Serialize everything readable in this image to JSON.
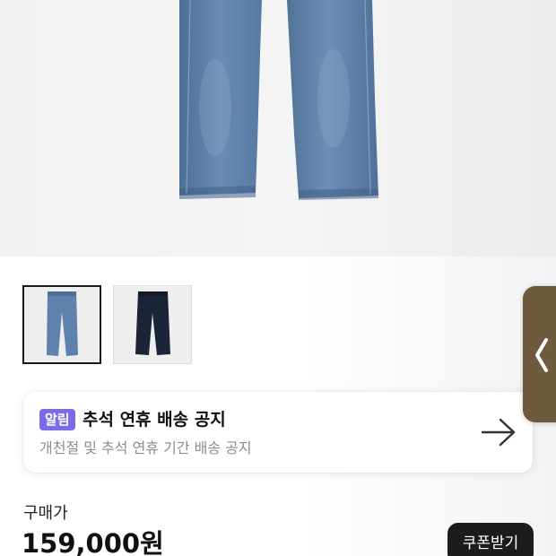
{
  "product": {
    "main_image": "jeans-front-light-wash",
    "thumbnails": [
      {
        "image": "light-wash-jeans",
        "selected": true
      },
      {
        "image": "dark-indigo-jeans",
        "selected": false
      }
    ]
  },
  "notice": {
    "badge": "알림",
    "title": "추석 연휴 배송 공지",
    "description": "개천절 및 추석 연휴 기간 배송 공지",
    "icon": "arrow-right-icon",
    "badge_color": "#7b6be6"
  },
  "price": {
    "label": "구매가",
    "amount": "159,000원"
  },
  "coupon_button": {
    "label": "쿠폰받기"
  },
  "side_handle": {
    "icon": "chevron-left-icon",
    "color": "#6e5a3d"
  }
}
